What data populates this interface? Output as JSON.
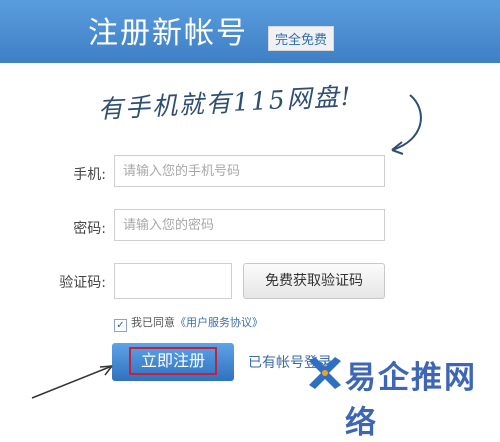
{
  "header": {
    "title": "注册新帐号",
    "badge": "完全免费"
  },
  "slogan": "有手机就有115网盘!",
  "form": {
    "phone": {
      "label": "手机:",
      "placeholder": "请输入您的手机号码"
    },
    "password": {
      "label": "密码:",
      "placeholder": "请输入您的密码"
    },
    "captcha": {
      "label": "验证码:",
      "value": "",
      "button_label": "免费获取验证码"
    },
    "agreement": {
      "text": "我已同意",
      "link": "《用户服务协议》",
      "checked": true
    },
    "submit_label": "立即注册",
    "login_link": "已有帐号登录"
  },
  "watermark": {
    "text": "易企推网络"
  },
  "colors": {
    "header_blue": "#4a8cd2",
    "button_blue": "#3f7fc6",
    "highlight_red": "#c4213d",
    "slogan_ink": "#2f4e73"
  }
}
